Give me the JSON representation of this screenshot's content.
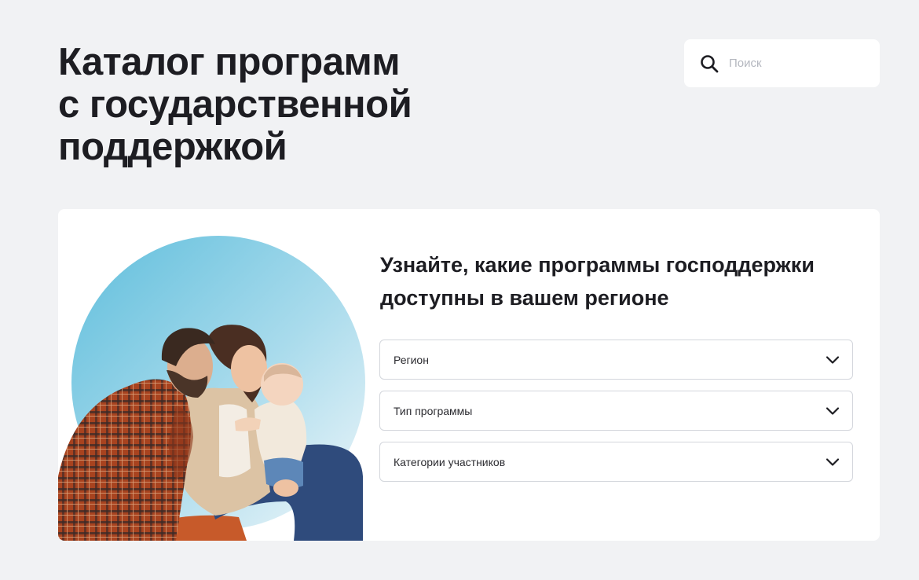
{
  "header": {
    "title_lines": [
      "Каталог программ",
      "с государственной",
      "поддержкой"
    ]
  },
  "search": {
    "placeholder": "Поиск",
    "value": ""
  },
  "filter_card": {
    "heading_lines": [
      "Узнайте, какие программы господдержки",
      "доступны в вашем регионе"
    ],
    "dropdowns": [
      {
        "label": "Регион"
      },
      {
        "label": "Тип программы"
      },
      {
        "label": "Категории участников"
      }
    ]
  },
  "icons": {
    "search": "search-icon",
    "dropdown": "chevron-down-icon"
  },
  "colors": {
    "page_background": "#f1f2f4",
    "text": "#1d1d22",
    "circle_gradient": [
      "#6cc3dd",
      "#e9f3f8"
    ]
  }
}
